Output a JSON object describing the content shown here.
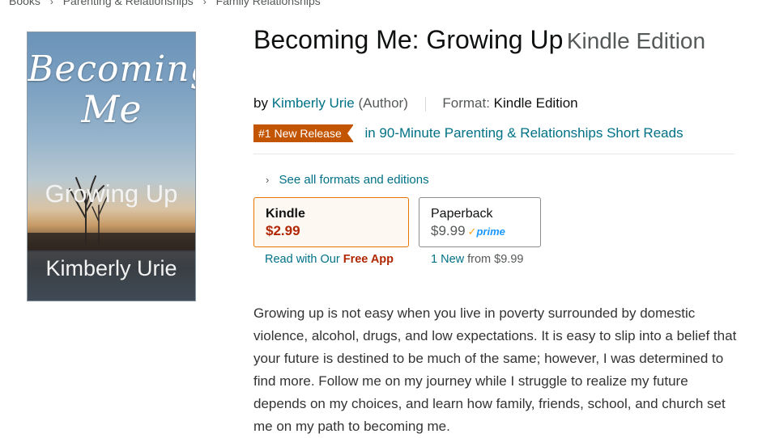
{
  "breadcrumb": {
    "items": [
      "Books",
      "Parenting & Relationships",
      "Family Relationships"
    ],
    "separator": "›"
  },
  "cover": {
    "title_line1": "Becoming",
    "title_line2": "Me",
    "subtitle": "Growing Up",
    "author": "Kimberly Urie"
  },
  "product": {
    "title": "Becoming Me: Growing Up",
    "title_suffix": "Kindle Edition",
    "by_prefix": "by",
    "author": "Kimberly Urie",
    "author_role": "(Author)",
    "format_label": "Format:",
    "format_value": "Kindle Edition"
  },
  "badge": {
    "label": "#1 New Release",
    "category_link": "in 90-Minute Parenting & Relationships Short Reads",
    "color": "#c45500"
  },
  "formats": {
    "see_all": "See all formats and editions",
    "options": [
      {
        "name": "Kindle",
        "price": "$2.99",
        "selected": true
      },
      {
        "name": "Paperback",
        "price": "$9.99",
        "prime_check": "✓",
        "prime_label": "prime",
        "selected": false
      }
    ],
    "kindle_note_prefix": "Read with Our",
    "kindle_note_link": "Free App",
    "paperback_note_link": "1 New",
    "paperback_note_from": "from",
    "paperback_note_price": "$9.99"
  },
  "description": "Growing up is not easy when you live in poverty surrounded by domestic violence, alcohol, drugs, and low expectations. It is easy to slip into a belief that your future is destined to be much of the same; however, I was determined to find more. Follow me on my journey while I struggle to realize my future depends on my choices, and learn how family, friends, school, and church set me on my path to becoming me.",
  "colors": {
    "link": "#007185",
    "price": "#b12704",
    "selected_border": "#e77600",
    "text": "#0f1111",
    "muted": "#565959"
  }
}
